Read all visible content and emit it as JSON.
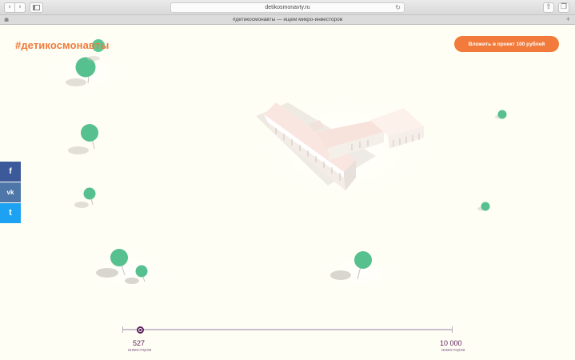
{
  "browser": {
    "url": "detikosmonavty.ru",
    "tab_title": "#детикосмонавты — ищем микро-инвесторов",
    "back_glyph": "‹",
    "forward_glyph": "›",
    "reload_glyph": "↻",
    "share_glyph": "⇧",
    "tabs_glyph": "❐",
    "home_glyph": "☗",
    "newtab_glyph": "+"
  },
  "header": {
    "hashtag": "#детикосмонавты",
    "cta_label": "Вложить в проект 100 рублей"
  },
  "social": {
    "facebook": "f",
    "vk": "vk",
    "twitter": "t"
  },
  "progress": {
    "current_count": "527",
    "current_label": "инвесторов",
    "goal_count": "10 000",
    "goal_label": "инвесторов",
    "current_value": 527,
    "goal_value": 10000
  },
  "colors": {
    "accent": "#f27a3b",
    "tree": "#56c08f",
    "progress": "#5a1f5a"
  }
}
